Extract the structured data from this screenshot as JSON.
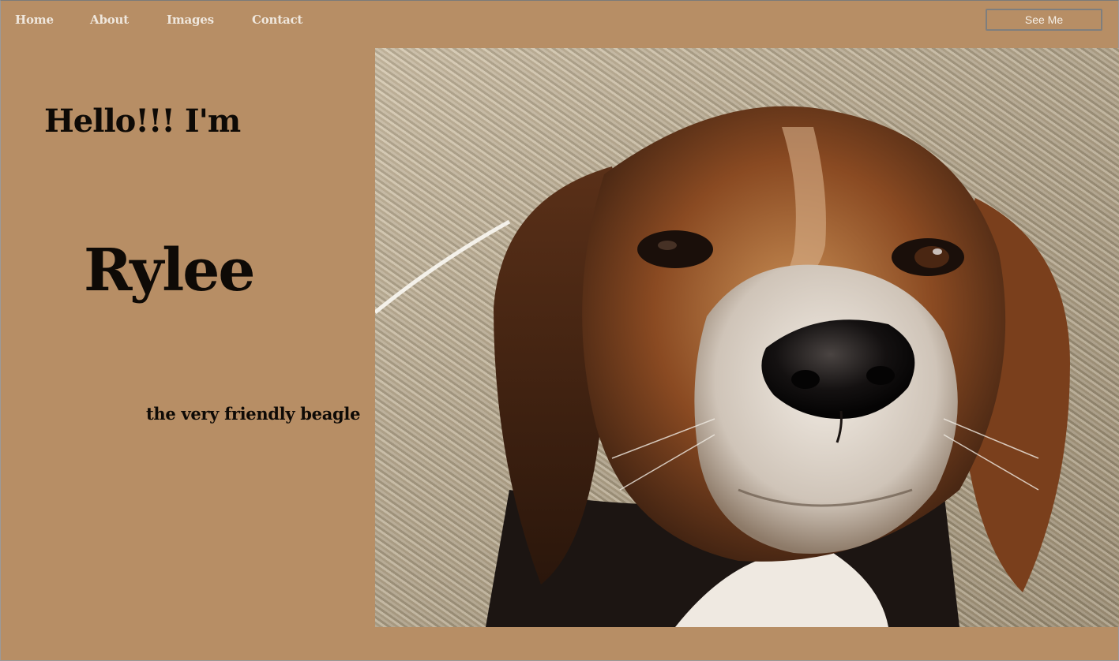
{
  "nav": {
    "items": [
      {
        "label": "Home"
      },
      {
        "label": "About"
      },
      {
        "label": "Images"
      },
      {
        "label": "Contact"
      }
    ],
    "cta_label": "See Me"
  },
  "hero": {
    "greeting": "Hello!!! I'm",
    "name": "Rylee",
    "tagline": "the very friendly beagle"
  },
  "colors": {
    "background": "#b78e65",
    "nav_text": "#efe7dd",
    "heading_text": "#0e0a06"
  },
  "photo": {
    "subject": "beagle-face-photo"
  }
}
